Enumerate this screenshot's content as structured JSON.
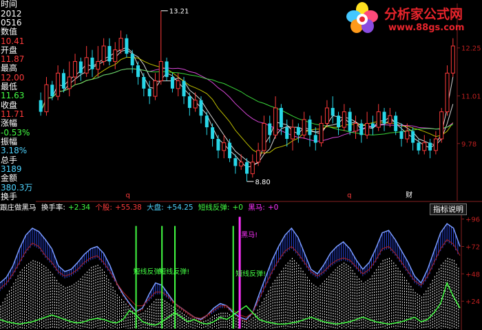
{
  "left_panel": {
    "time_label": "时间",
    "date_year": "2012",
    "date_md": "0516",
    "value_label": "数值",
    "value": "10.41",
    "open_label": "开盘",
    "open": "11.87",
    "high_label": "最高",
    "high": "12.00",
    "low_label": "最低",
    "low": "11.63",
    "close_label": "收盘",
    "close": "11.71",
    "change_label": "涨幅",
    "change": "-0.53%",
    "amplitude_label": "振幅",
    "amplitude": "3.18%",
    "volume_label": "总手",
    "volume": "3189",
    "amount_label": "金额",
    "amount": "380.3万",
    "turnover_label": "换手"
  },
  "logo": {
    "title": "分析家公式网",
    "url": "www.88gs.com"
  },
  "colors": {
    "up": "#ff3b3b",
    "down": "#28d7e8",
    "ma": "#ffffff",
    "cyan": "#4fd4ff",
    "green": "#44ff44",
    "magenta": "#ff33ff",
    "blue": "#2a44d8",
    "fill_red": "#c82828",
    "yellow": "#e0e000"
  },
  "indicator_bar": {
    "name": "跟庄做黑马",
    "turnover_label": "换手率:",
    "turnover": "+2.34",
    "retail_label": "个股:",
    "retail": "+55.38",
    "market_label": "大盘:",
    "market": "+54.25",
    "rebound_label": "短线反弹:",
    "rebound": "+0",
    "blackhorse_label": "黑马:",
    "blackhorse": "+0"
  },
  "help_button": "指标说明",
  "chart_data": [
    {
      "type": "candlestick",
      "y_ticks": [
        12.25,
        11.01,
        9.78
      ],
      "ylim": [
        8.55,
        13.4
      ],
      "annotations": [
        {
          "text": "13.21",
          "value": 13.21
        },
        {
          "text": "8.80",
          "value": 8.8
        }
      ],
      "markers": [
        "q",
        "q",
        "财"
      ],
      "candles": [
        [
          10.9,
          10.6,
          11.1,
          10.5
        ],
        [
          10.6,
          11.3,
          11.5,
          10.5
        ],
        [
          11.3,
          11.0,
          11.4,
          10.9
        ],
        [
          11.0,
          11.6,
          11.8,
          10.9
        ],
        [
          11.6,
          11.2,
          11.7,
          11.1
        ],
        [
          11.2,
          11.5,
          11.9,
          11.0
        ],
        [
          11.5,
          11.9,
          12.1,
          11.3
        ],
        [
          11.9,
          11.6,
          12.0,
          11.4
        ],
        [
          11.6,
          12.0,
          12.3,
          11.5
        ],
        [
          12.0,
          11.7,
          12.2,
          11.5
        ],
        [
          11.7,
          11.9,
          12.3,
          11.5
        ],
        [
          11.9,
          12.3,
          12.5,
          11.8
        ],
        [
          12.3,
          11.9,
          12.5,
          11.8
        ],
        [
          11.9,
          12.2,
          12.4,
          11.7
        ],
        [
          12.2,
          12.5,
          12.7,
          12.1
        ],
        [
          12.5,
          12.1,
          12.6,
          12.0
        ],
        [
          12.1,
          11.8,
          12.2,
          11.6
        ],
        [
          11.8,
          11.5,
          11.9,
          11.3
        ],
        [
          11.5,
          11.2,
          11.6,
          11.0
        ],
        [
          11.2,
          11.0,
          11.4,
          10.8
        ],
        [
          11.0,
          11.4,
          11.6,
          10.9
        ],
        [
          11.4,
          11.9,
          13.21,
          11.3
        ],
        [
          11.9,
          11.5,
          12.0,
          11.4
        ],
        [
          11.5,
          11.2,
          11.6,
          11.1
        ],
        [
          11.2,
          11.4,
          11.6,
          11.0
        ],
        [
          11.4,
          11.0,
          11.5,
          10.8
        ],
        [
          11.0,
          10.7,
          11.1,
          10.5
        ],
        [
          10.7,
          10.9,
          11.1,
          10.6
        ],
        [
          10.9,
          10.5,
          11.0,
          10.3
        ],
        [
          10.5,
          10.2,
          10.6,
          10.0
        ],
        [
          10.2,
          9.9,
          10.3,
          9.7
        ],
        [
          9.9,
          9.6,
          10.0,
          9.4
        ],
        [
          9.6,
          9.8,
          10.0,
          9.4
        ],
        [
          9.8,
          9.4,
          9.9,
          9.3
        ],
        [
          9.4,
          9.2,
          9.5,
          9.0
        ],
        [
          9.2,
          9.3,
          9.5,
          9.1
        ],
        [
          9.3,
          9.0,
          9.4,
          8.8
        ],
        [
          9.0,
          9.3,
          9.5,
          8.9
        ],
        [
          9.3,
          9.6,
          9.8,
          9.2
        ],
        [
          9.6,
          10.3,
          10.5,
          9.5
        ],
        [
          10.3,
          10.0,
          10.5,
          9.8
        ],
        [
          10.0,
          10.7,
          11.0,
          9.9
        ],
        [
          10.7,
          10.2,
          10.8,
          10.0
        ],
        [
          10.2,
          9.9,
          10.4,
          9.7
        ],
        [
          9.9,
          10.2,
          10.4,
          9.6
        ],
        [
          10.2,
          10.0,
          10.3,
          9.8
        ],
        [
          10.0,
          10.4,
          10.6,
          9.9
        ],
        [
          10.4,
          10.0,
          10.5,
          9.7
        ],
        [
          10.0,
          9.8,
          10.2,
          9.6
        ],
        [
          9.8,
          10.3,
          10.5,
          9.7
        ],
        [
          10.3,
          10.7,
          10.9,
          10.2
        ],
        [
          10.7,
          10.5,
          11.0,
          10.3
        ],
        [
          10.5,
          10.2,
          10.6,
          10.0
        ],
        [
          10.2,
          10.6,
          10.8,
          10.1
        ],
        [
          10.6,
          10.1,
          10.7,
          10.0
        ],
        [
          10.1,
          10.3,
          10.5,
          9.9
        ],
        [
          10.3,
          10.0,
          10.4,
          9.8
        ],
        [
          10.0,
          10.3,
          10.6,
          9.9
        ],
        [
          10.3,
          10.2,
          10.5,
          10.0
        ],
        [
          10.2,
          10.6,
          10.8,
          10.1
        ],
        [
          10.6,
          10.3,
          10.7,
          10.1
        ],
        [
          10.3,
          10.5,
          10.7,
          10.2
        ],
        [
          10.5,
          10.1,
          10.6,
          10.0
        ],
        [
          10.1,
          9.9,
          10.3,
          9.7
        ],
        [
          9.9,
          10.1,
          10.3,
          9.8
        ],
        [
          10.1,
          9.8,
          10.2,
          9.6
        ],
        [
          9.8,
          9.6,
          9.9,
          9.5
        ],
        [
          9.6,
          9.8,
          10.0,
          9.5
        ],
        [
          9.8,
          9.6,
          9.9,
          9.4
        ],
        [
          9.6,
          9.9,
          10.1,
          9.5
        ],
        [
          9.9,
          10.6,
          10.7,
          9.8
        ],
        [
          10.6,
          11.6,
          11.8,
          10.5
        ],
        [
          11.6,
          12.3,
          12.5,
          11.5
        ]
      ]
    },
    {
      "type": "area",
      "name": "跟庄做黑马",
      "y_ticks": [
        96,
        72,
        48,
        24
      ],
      "ylim": [
        0,
        100
      ],
      "labels": [
        "短线反弹!",
        "短线反弹!",
        "黑马!",
        "短线反弹!"
      ],
      "series": [
        {
          "values": [
            40,
            45,
            55,
            70,
            82,
            88,
            85,
            78,
            70,
            55,
            50,
            52,
            58,
            65,
            70,
            72,
            66,
            55,
            40,
            30,
            22,
            15,
            18,
            30,
            40,
            38,
            30,
            22,
            18,
            14,
            10,
            8,
            12,
            18,
            22,
            20,
            14,
            10,
            8,
            14,
            30,
            45,
            60,
            72,
            82,
            88,
            80,
            66,
            52,
            48,
            56,
            66,
            72,
            76,
            70,
            60,
            52,
            58,
            70,
            84,
            86,
            78,
            68,
            58,
            46,
            40,
            52,
            68,
            84,
            92,
            88,
            72
          ]
        },
        {
          "values": [
            35,
            40,
            48,
            58,
            68,
            75,
            72,
            64,
            58,
            50,
            46,
            48,
            52,
            58,
            62,
            64,
            58,
            50,
            40,
            32,
            26,
            20,
            20,
            26,
            32,
            32,
            28,
            22,
            18,
            14,
            10,
            9,
            12,
            16,
            20,
            20,
            16,
            12,
            10,
            14,
            26,
            38,
            50,
            60,
            68,
            72,
            66,
            58,
            50,
            46,
            50,
            56,
            60,
            62,
            60,
            54,
            48,
            52,
            60,
            70,
            72,
            66,
            58,
            50,
            42,
            38,
            46,
            58,
            70,
            78,
            74,
            64
          ]
        },
        {
          "values": [
            20,
            30,
            40,
            50,
            56,
            60,
            58,
            54,
            48,
            40,
            36,
            38,
            42,
            48,
            54,
            56,
            50,
            40,
            30,
            24,
            18,
            12,
            14,
            20,
            26,
            26,
            22,
            18,
            14,
            10,
            8,
            6,
            8,
            12,
            14,
            14,
            10,
            8,
            6,
            10,
            20,
            30,
            40,
            48,
            56,
            62,
            56,
            48,
            40,
            36,
            42,
            48,
            54,
            58,
            54,
            46,
            40,
            44,
            52,
            60,
            62,
            56,
            48,
            40,
            32,
            28,
            36,
            46,
            56,
            62,
            60,
            50
          ]
        },
        {
          "values": [
            8,
            6,
            5,
            4,
            5,
            6,
            8,
            10,
            12,
            10,
            8,
            6,
            5,
            6,
            8,
            9,
            8,
            6,
            5,
            8,
            16,
            12,
            6,
            4,
            3,
            6,
            10,
            14,
            10,
            6,
            8,
            5,
            4,
            6,
            10,
            8,
            12,
            16,
            20,
            14,
            8,
            6,
            5,
            4,
            4,
            5,
            6,
            8,
            10,
            8,
            6,
            5,
            4,
            5,
            6,
            8,
            10,
            8,
            6,
            5,
            4,
            5,
            6,
            8,
            10,
            6,
            8,
            14,
            22,
            40,
            28,
            18
          ]
        },
        {
          "values": [
            0,
            0,
            0,
            0,
            0,
            0,
            0,
            0,
            0,
            0,
            0,
            0,
            0,
            0,
            0,
            0,
            0,
            0,
            0,
            0,
            0,
            100,
            0,
            0,
            0,
            100,
            0,
            100,
            0,
            0,
            0,
            0,
            0,
            0,
            0,
            0,
            100,
            0,
            0,
            0,
            0,
            0,
            0,
            0,
            0,
            0,
            0,
            0,
            0,
            0,
            0,
            0,
            0,
            0,
            0,
            0,
            0,
            0,
            0,
            0,
            0,
            0,
            0,
            0,
            0,
            0,
            0,
            0,
            0,
            0,
            0,
            0
          ]
        },
        {
          "values": [
            0,
            0,
            0,
            0,
            0,
            0,
            0,
            0,
            0,
            0,
            0,
            0,
            0,
            0,
            0,
            0,
            0,
            0,
            0,
            0,
            0,
            0,
            0,
            0,
            0,
            0,
            0,
            0,
            0,
            0,
            0,
            0,
            0,
            0,
            0,
            0,
            0,
            0,
            0,
            0,
            0,
            0,
            0,
            0,
            0,
            0,
            0,
            0,
            0,
            0,
            0,
            0,
            0,
            0,
            0,
            0,
            0,
            0,
            0,
            0,
            0,
            0,
            0,
            0,
            0,
            0,
            0,
            0,
            0,
            0,
            0,
            0
          ]
        }
      ]
    }
  ]
}
